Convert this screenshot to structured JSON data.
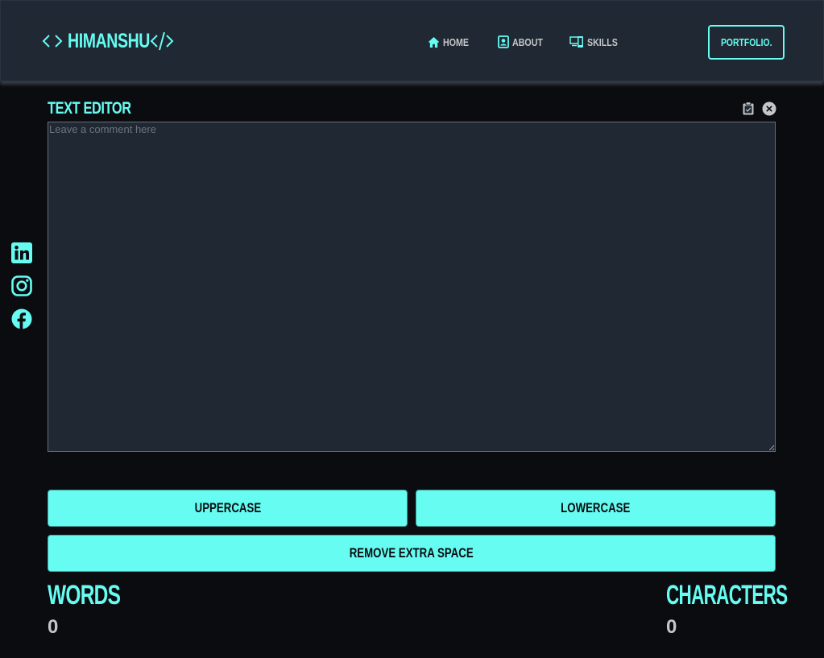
{
  "navbar": {
    "brand": "HIMANSHU",
    "links": [
      {
        "label": "HOME",
        "icon": "home-icon"
      },
      {
        "label": "ABOUT",
        "icon": "contact-card-icon"
      },
      {
        "label": "SKILLS",
        "icon": "devices-icon"
      }
    ],
    "cta_label": "PORTFOLIO."
  },
  "social": [
    "linkedin-icon",
    "instagram-icon",
    "facebook-icon"
  ],
  "editor": {
    "title": "TEXT EDITOR",
    "placeholder": "Leave a comment here",
    "value": ""
  },
  "actions": {
    "uppercase": "UPPERCASE",
    "lowercase": "LOWERCASE",
    "remove_space": "REMOVE EXTRA SPACE"
  },
  "stats": {
    "words_label": "WORDS",
    "words_value": "0",
    "chars_label": "CHARACTERS",
    "chars_value": "0"
  },
  "colors": {
    "accent": "#66fcf1",
    "background": "#0b0c10",
    "surface": "#1f2833",
    "muted_text": "#c5c6c7"
  }
}
